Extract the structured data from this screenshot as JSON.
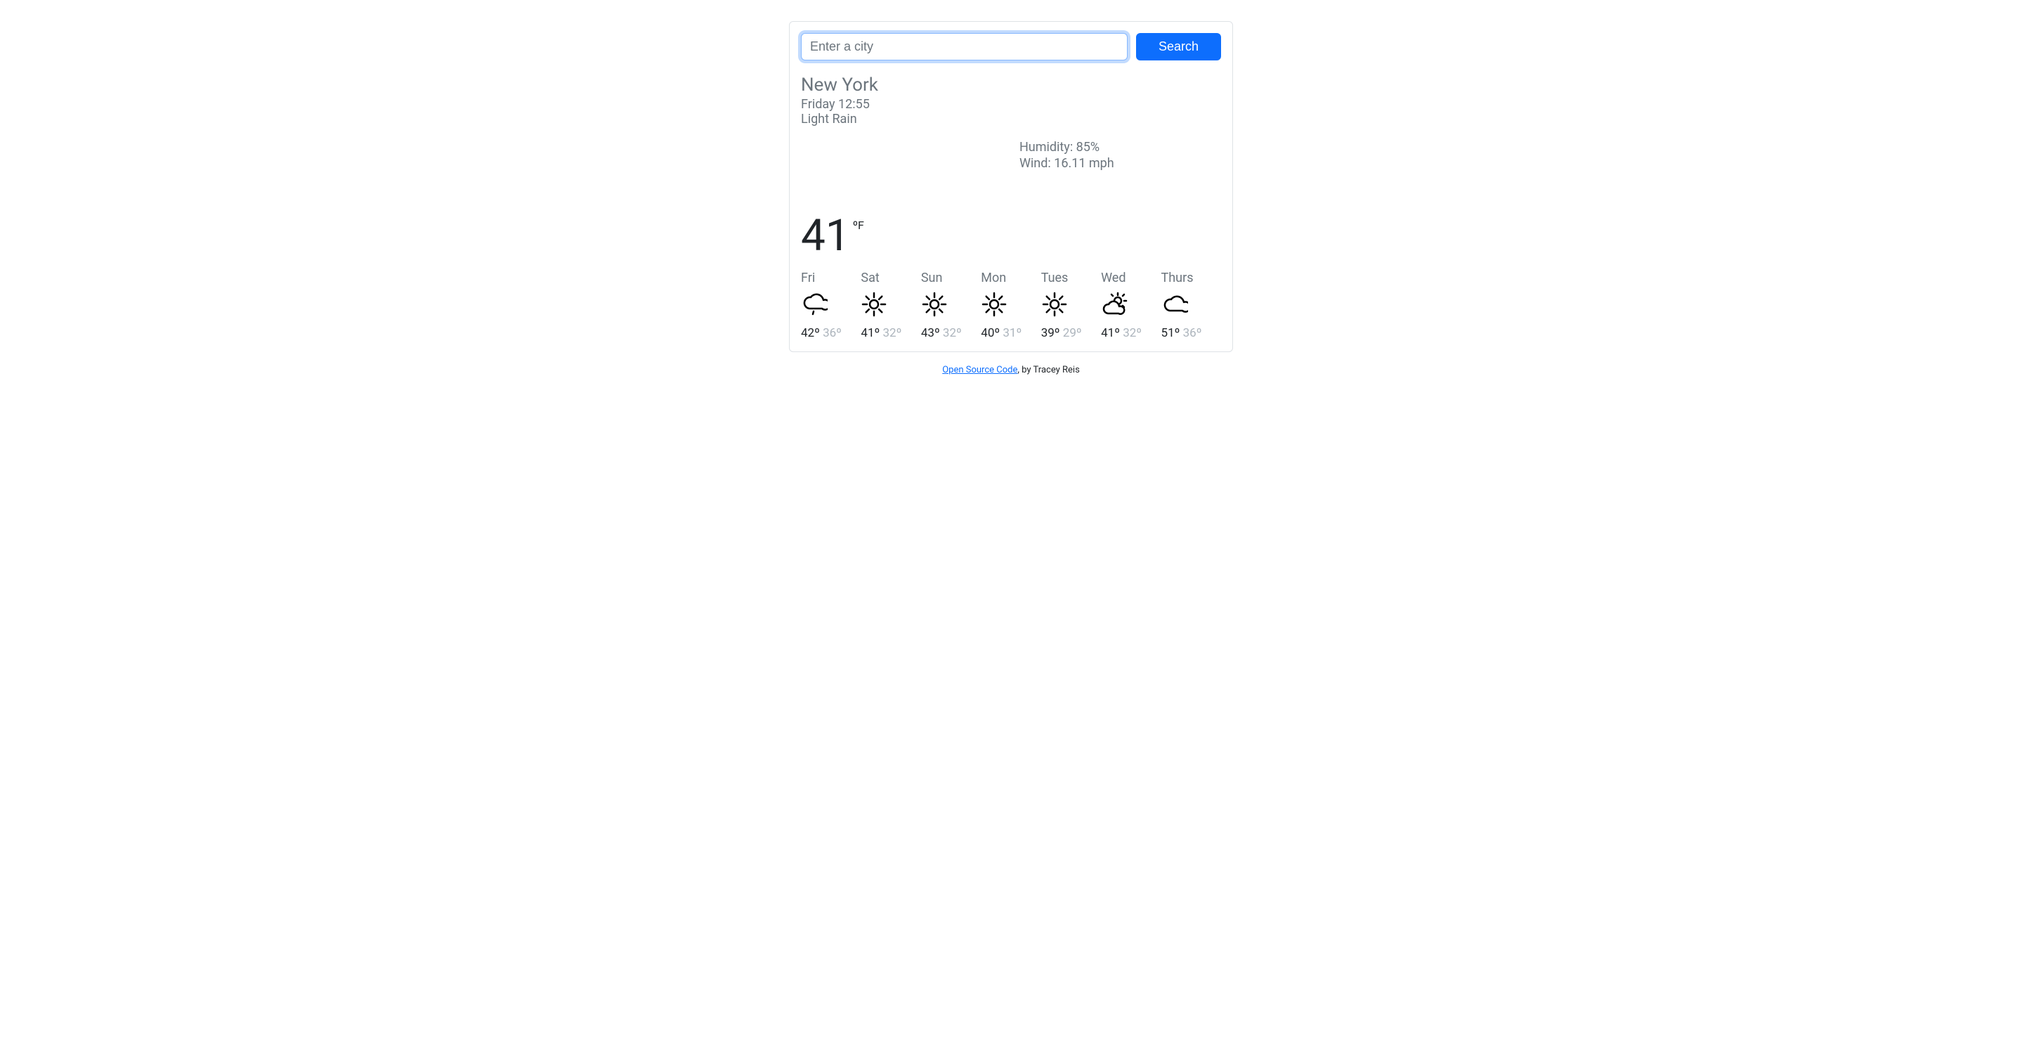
{
  "search": {
    "placeholder": "Enter a city",
    "button_label": "Search"
  },
  "current": {
    "city": "New York",
    "datetime": "Friday 12:55",
    "condition": "Light Rain",
    "humidity_label": "Humidity: ",
    "humidity_value": "85%",
    "wind_label": "Wind: ",
    "wind_value": "16.11 mph",
    "temp": "41",
    "unit": "ºF"
  },
  "forecast": [
    {
      "day": "Fri",
      "icon": "rain",
      "high": "42º",
      "low": "36º"
    },
    {
      "day": "Sat",
      "icon": "sun",
      "high": "41º",
      "low": "32º"
    },
    {
      "day": "Sun",
      "icon": "sun",
      "high": "43º",
      "low": "32º"
    },
    {
      "day": "Mon",
      "icon": "sun",
      "high": "40º",
      "low": "31º"
    },
    {
      "day": "Tues",
      "icon": "sun",
      "high": "39º",
      "low": "29º"
    },
    {
      "day": "Wed",
      "icon": "partly-cloudy",
      "high": "41º",
      "low": "32º"
    },
    {
      "day": "Thurs",
      "icon": "cloud",
      "high": "51º",
      "low": "36º"
    }
  ],
  "footer": {
    "link_text": "Open Source Code",
    "byline": ", by Tracey Reis"
  }
}
